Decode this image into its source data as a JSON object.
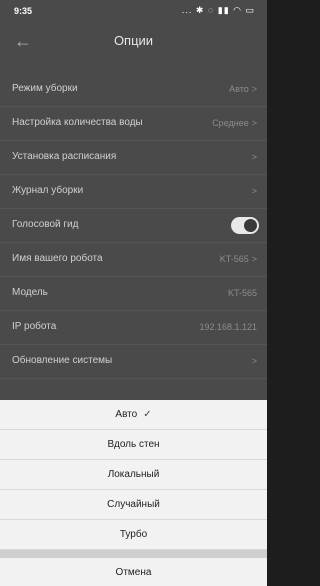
{
  "status": {
    "time": "9:35",
    "icons": "... ✱ ◌ ▮▮ ◠ ▭"
  },
  "header": {
    "back_icon": "←",
    "title": "Опции"
  },
  "settings": [
    {
      "label": "Режим уборки",
      "value": "Авто",
      "chevron": ">"
    },
    {
      "label": "Настройка количества воды",
      "value": "Среднее",
      "chevron": ">"
    },
    {
      "label": "Установка расписания",
      "value": "",
      "chevron": ">"
    },
    {
      "label": "Журнал уборки",
      "value": "",
      "chevron": ">"
    },
    {
      "label": "Голосовой гид",
      "value": "",
      "chevron": ""
    },
    {
      "label": "Имя вашего робота",
      "value": "KT-565",
      "chevron": ">"
    },
    {
      "label": "Модель",
      "value": "KT-565",
      "chevron": ""
    },
    {
      "label": "IP робота",
      "value": "192.168.1.121",
      "chevron": ""
    },
    {
      "label": "Обновление системы",
      "value": "",
      "chevron": ">"
    }
  ],
  "voice_toggle": {
    "on": true
  },
  "sheet": {
    "options": [
      "Авто",
      "Вдоль стен",
      "Локальный",
      "Случайный",
      "Турбо"
    ],
    "selected": "Авто",
    "check_mark": "✓",
    "cancel": "Отмена"
  }
}
